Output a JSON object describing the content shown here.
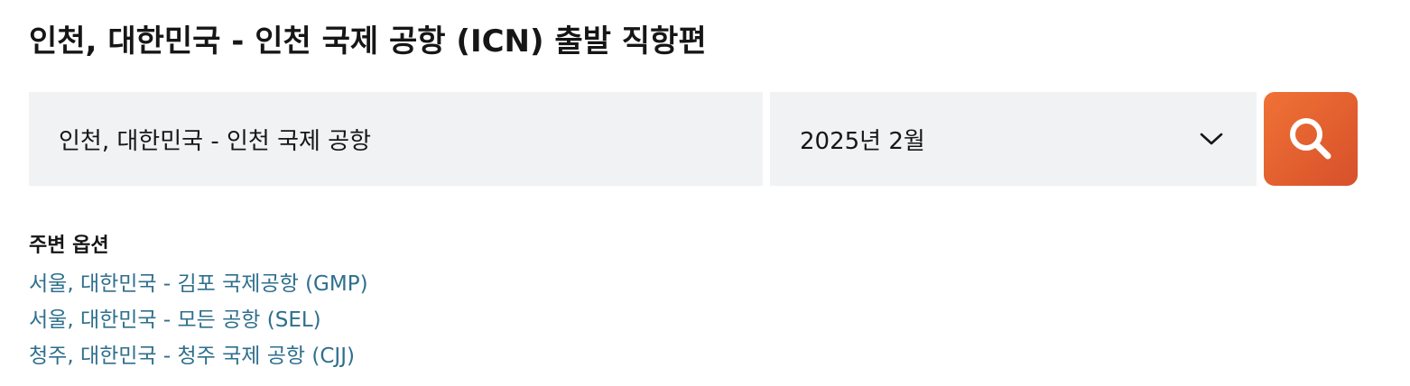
{
  "page": {
    "title": "인천, 대한민국 - 인천 국제 공항 (ICN) 출발 직항편"
  },
  "search_form": {
    "origin_value": "인천, 대한민국 - 인천 국제 공항",
    "month_value": "2025년 2월",
    "month_dropdown_icon": "chevron-down-icon",
    "search_button_icon": "search-icon",
    "search_button_color": "#e9622f"
  },
  "nearby": {
    "heading": "주변 옵션",
    "options": [
      {
        "label": "서울, 대한민국 - 김포 국제공항 (GMP)"
      },
      {
        "label": "서울, 대한민국 - 모든 공항 (SEL)"
      },
      {
        "label": "청주, 대한민국 - 청주 국제 공항 (CJJ)"
      }
    ],
    "link_color": "#2e6f8e"
  }
}
